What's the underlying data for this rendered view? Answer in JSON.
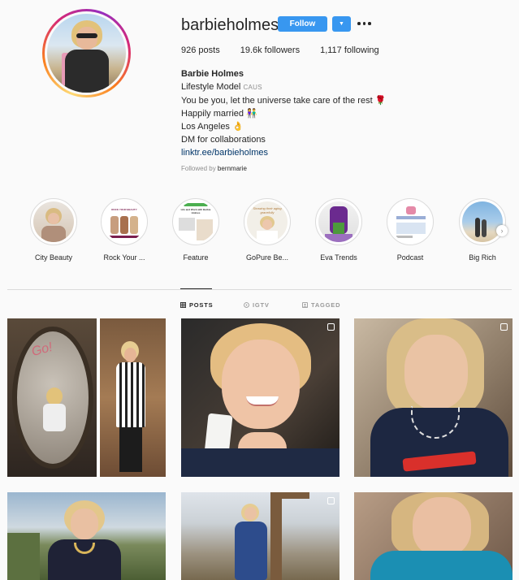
{
  "profile": {
    "username": "barbieholmes",
    "follow_label": "Follow",
    "stats": {
      "posts": "926 posts",
      "followers": "19.6k followers",
      "following": "1,117 following"
    },
    "bio": {
      "full_name": "Barbie Holmes",
      "line1_main": "Lifestyle Model",
      "line1_tag": "CAUS",
      "line2": "You be you, let the universe take care of the rest 🌹",
      "line3": "Happily married 👫",
      "line4": "Los Angeles 👌",
      "line5": "DM for collaborations",
      "link": "linktr.ee/barbieholmes"
    },
    "followed_by_prefix": "Followed by",
    "followed_by_user": "bernmarie"
  },
  "highlights": [
    {
      "label": "City Beauty"
    },
    {
      "label": "Rock Your ..."
    },
    {
      "label": "Feature"
    },
    {
      "label": "GoPure Be..."
    },
    {
      "label": "Eva Trends"
    },
    {
      "label": "Podcast"
    },
    {
      "label": "Big Rich"
    }
  ],
  "highlight_image_text": {
    "rock": "ROCK YOUR BEAUTY",
    "feature": "Life and Work with Barbie Holmes",
    "gopure": "Showing their aging gracefully"
  },
  "tabs": {
    "posts": "POSTS",
    "igtv": "IGTV",
    "tagged": "TAGGED"
  },
  "colors": {
    "accent": "#3897f0",
    "link": "#003569",
    "muted": "#8e8e8e"
  }
}
